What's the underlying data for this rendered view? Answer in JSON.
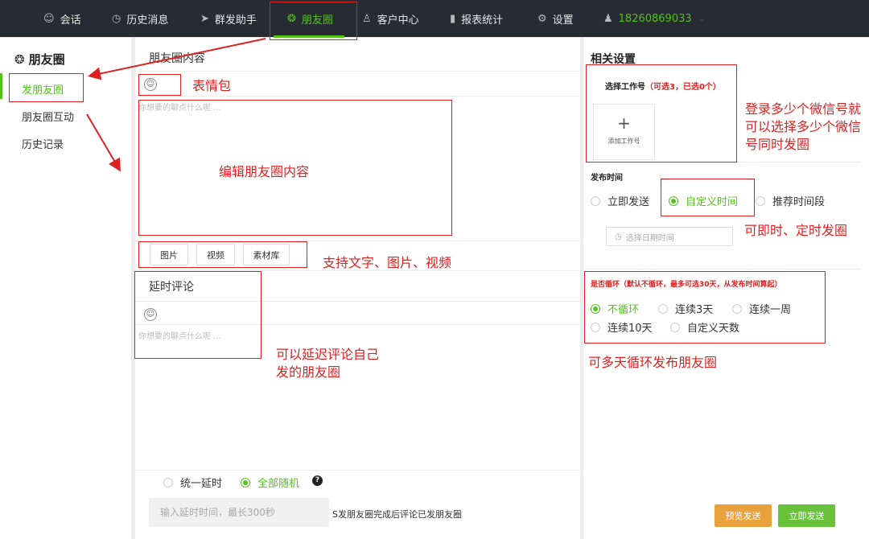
{
  "nav": {
    "items": [
      {
        "icon": "chat-bubble-icon",
        "label": "会话"
      },
      {
        "icon": "clock-icon",
        "label": "历史消息"
      },
      {
        "icon": "paper-plane-icon",
        "label": "群发助手"
      },
      {
        "icon": "aperture-icon",
        "label": "朋友圈"
      },
      {
        "icon": "user-icon",
        "label": "客户中心"
      },
      {
        "icon": "bar-chart-icon",
        "label": "报表统计"
      },
      {
        "icon": "gear-icon",
        "label": "设置"
      }
    ],
    "active": "朋友圈",
    "phone": "18260869033",
    "accent_color": "#52c41a"
  },
  "sidebar": {
    "title": "朋友圈",
    "items": [
      "发朋友圈",
      "朋友圈互动",
      "历史记录"
    ],
    "active": "发朋友圈"
  },
  "middle": {
    "title": "朋友圈内容",
    "placeholder": "你想要的聊点什么呢 ...",
    "media_buttons": [
      "图片",
      "视频",
      "素材库"
    ],
    "delay_title": "延时评论",
    "delay_placeholder": "你想要的聊点什么呢 ...",
    "delay_modes": [
      "统一延时",
      "全部随机"
    ],
    "delay_mode_selected": "全部随机",
    "help": "?",
    "delay_input_placeholder": "输入延时时间，最长300秒",
    "delay_suffix": "S发朋友圈完成后评论已发朋友圈"
  },
  "right": {
    "title": "相关设置",
    "account_label": "选择工作号",
    "account_hint": "（可选3，已选0个）",
    "add_plus": "+",
    "add_label": "添加工作号",
    "publish_time_label": "发布时间",
    "publish_options": [
      "立即发送",
      "自定义时间",
      "推荐时间段"
    ],
    "publish_selected": "自定义时间",
    "date_placeholder": "选择日期时间",
    "loop_label": "是否循环（默认不循环，最多可选30天，从发布时间算起）",
    "loop_options": [
      "不循环",
      "连续3天",
      "连续一周",
      "连续10天",
      "自定义天数"
    ],
    "loop_selected": "不循环",
    "preview_button": "预览发送",
    "send_button": "立即发送",
    "preview_color": "#e9a23b",
    "send_color": "#67c23a"
  },
  "annotations": {
    "emoji": "表情包",
    "edit": "编辑朋友圈内容",
    "media": "支持文字、图片、视频",
    "delay": "可以延迟评论自己发的朋友圈",
    "accounts": "登录多少个微信号就可以选择多少个微信号同时发圈",
    "timing": "可即时、定时发圈",
    "loop": "可多天循环发布朋友圈",
    "color": "#e02020"
  }
}
